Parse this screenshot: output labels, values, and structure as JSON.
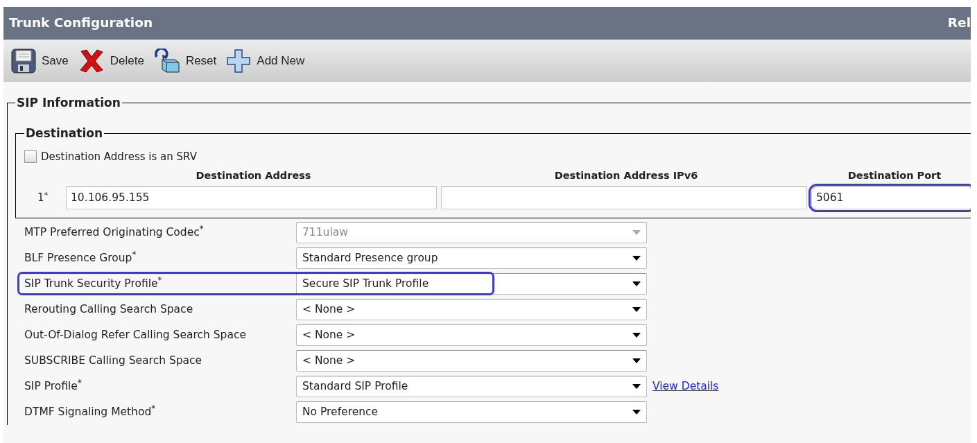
{
  "window": {
    "title": "Trunk Configuration",
    "title_right": "Rel"
  },
  "toolbar": [
    {
      "kind": "save",
      "label": "Save"
    },
    {
      "kind": "delete",
      "label": "Delete"
    },
    {
      "kind": "reset",
      "label": "Reset"
    },
    {
      "kind": "add",
      "label": "Add New"
    }
  ],
  "sip_information": {
    "legend": "SIP Information",
    "destination": {
      "legend": "Destination",
      "srv_checkbox": {
        "label": "Destination Address is an SRV",
        "checked": false
      },
      "columns": [
        "Destination Address",
        "Destination Address IPv6",
        "Destination Port"
      ],
      "rows": [
        {
          "index": "1$^{*}$",
          "address": "10.106.95.155",
          "port": "5061",
          "port_highlighted": true
        }
      ]
    },
    "fields": [
      {
        "label": "MTP Preferred Originating Codec$^{*}$",
        "value": "711ulaw",
        "disabled": true,
        "highlighted": false
      },
      {
        "label": "BLF Presence Group$^{*}$",
        "value": "Standard Presence group",
        "disabled": false,
        "highlighted": false
      },
      {
        "label": "SIP Trunk Security Profile$^{*}$",
        "value": "Secure SIP Trunk Profile",
        "disabled": false,
        "highlighted": true
      },
      {
        "label": "Rerouting Calling Search Space",
        "value": "< None >",
        "disabled": false,
        "highlighted": false
      },
      {
        "label": "Out-Of-Dialog Refer Calling Search Space",
        "value": "< None >",
        "disabled": false,
        "highlighted": false
      },
      {
        "label": "SUBSCRIBE Calling Search Space",
        "value": "< None >",
        "disabled": false,
        "highlighted": false
      },
      {
        "label": "SIP Profile$^{*}$",
        "value": "Standard SIP Profile",
        "disabled": false,
        "highlighted": false,
        "link": "View Details"
      },
      {
        "label": "DTMF Signaling Method$^{*}$",
        "value": "No Preference",
        "disabled": false,
        "highlighted": false
      }
    ]
  }
}
